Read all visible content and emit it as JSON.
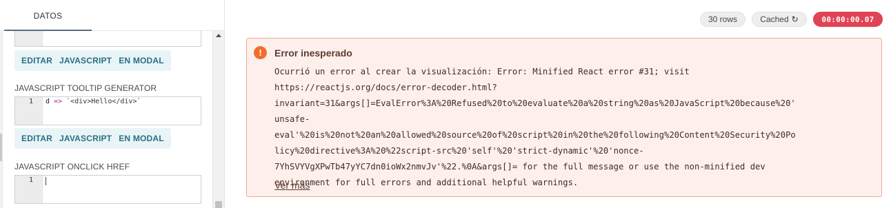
{
  "tabs": {
    "active_label": "DATOS"
  },
  "editors": [
    {
      "lines": []
    },
    {
      "line_number": "1",
      "code_prefix": "d ",
      "code_arrow": "=>",
      "code_string": " `<div>Hello</div>`"
    },
    {
      "line_number": "1",
      "code_prefix": ""
    }
  ],
  "buttons": {
    "row1": [
      "EDITAR",
      "JAVASCRIPT",
      "EN MODAL"
    ],
    "row2": [
      "EDITAR",
      "JAVASCRIPT",
      "EN MODAL"
    ]
  },
  "labels": {
    "tooltip_generator": "JAVASCRIPT TOOLTIP GENERATOR",
    "onclick_href": "JAVASCRIPT ONCLICK HREF"
  },
  "status": {
    "rows": "30 rows",
    "cached": "Cached",
    "cached_icon": "refresh-icon",
    "timer": "00:00:00.07"
  },
  "colors": {
    "timer_bg": "#e04355",
    "alert_bg": "#fdf0ec",
    "alert_border": "#f1a98a",
    "alert_icon": "#f06d2c",
    "button_text": "#2a6f86"
  },
  "alert": {
    "icon": "exclamation-icon",
    "title": "Error inesperado",
    "lines": [
      "Ocurrió un error al crear la visualización: Error: Minified React error #31; visit",
      "https://reactjs.org/docs/error-decoder.html?",
      "invariant=31&args[]=EvalError%3A%20Refused%20to%20evaluate%20a%20string%20as%20JavaScript%20because%20'",
      "unsafe-",
      "eval'%20is%20not%20an%20allowed%20source%20of%20script%20in%20the%20following%20Content%20Security%20Po",
      "licy%20directive%3A%20%22script-src%20'self'%20'strict-dynamic'%20'nonce-",
      "7YhSVYVgXPwTb47yYC7dn0ioWx2nmvJv'%22.%0A&args[]= for the full message or use the non-minified dev",
      "environment for full errors and additional helpful warnings."
    ],
    "link": "Ver más"
  }
}
